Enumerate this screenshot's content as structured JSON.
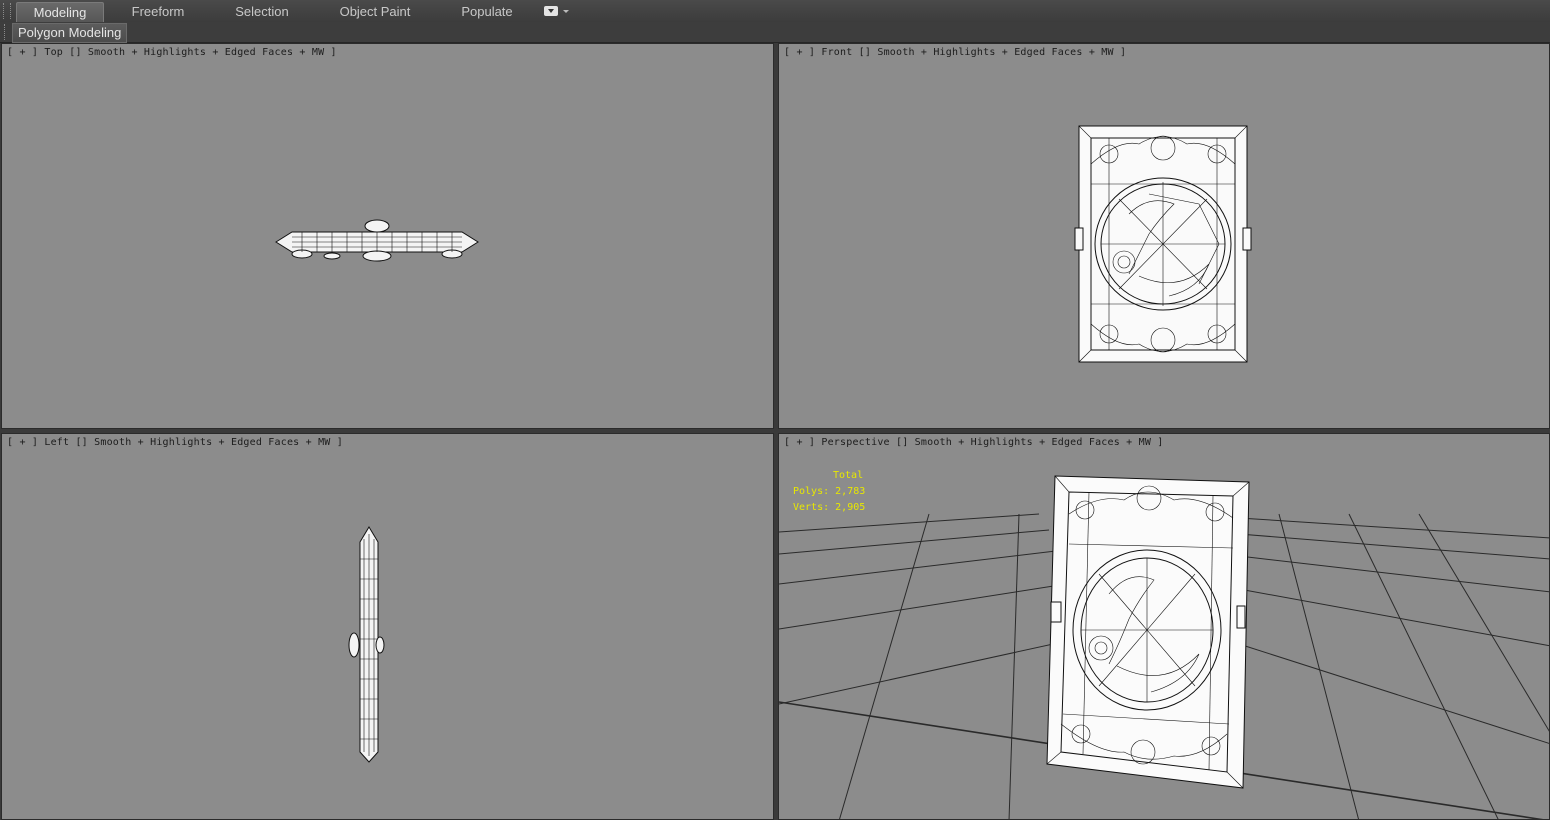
{
  "ribbon": {
    "tabs": [
      {
        "label": "Modeling",
        "active": true
      },
      {
        "label": "Freeform",
        "active": false
      },
      {
        "label": "Selection",
        "active": false
      },
      {
        "label": "Object Paint",
        "active": false
      },
      {
        "label": "Populate",
        "active": false
      }
    ],
    "panel_label": "Polygon Modeling"
  },
  "viewports": {
    "top": {
      "open": "[ + ]",
      "view": "Top",
      "shading": "Smooth + Highlights + Edged Faces + MW ]"
    },
    "front": {
      "open": "[ + ]",
      "view": "Front",
      "shading": "Smooth + Highlights + Edged Faces + MW ]"
    },
    "left": {
      "open": "[ + ]",
      "view": "Left",
      "shading": "Smooth + Highlights + Edged Faces + MW ]"
    },
    "perspective": {
      "open": "[ + ]",
      "view": "Perspective",
      "shading": "Smooth + Highlights + Edged Faces + MW ]"
    }
  },
  "stats": {
    "title": "Total",
    "polys_label": "Polys:",
    "polys_value": "2,783",
    "verts_label": "Verts:",
    "verts_value": "2,905"
  },
  "colors": {
    "viewport_bg": "#8c8c8c",
    "stats_text": "#e8e800",
    "active_tab": "#606060"
  }
}
